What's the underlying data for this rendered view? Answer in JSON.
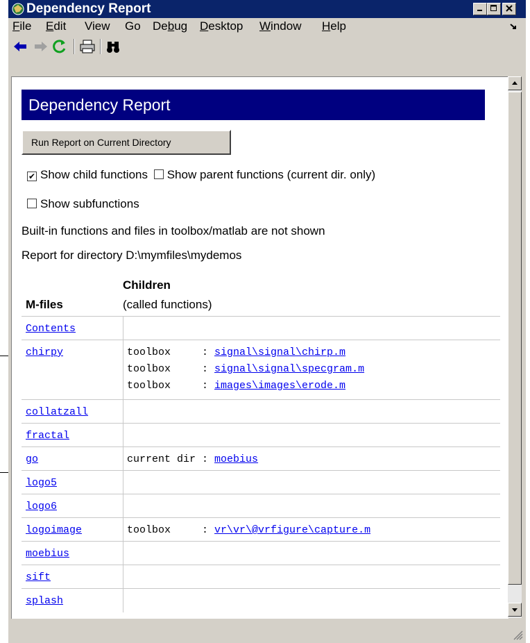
{
  "window": {
    "title": "Dependency Report"
  },
  "menu": {
    "items": [
      {
        "label": "File",
        "u": "F",
        "rest": "ile"
      },
      {
        "label": "Edit",
        "u": "E",
        "rest": "dit"
      },
      {
        "label": "View",
        "u": "",
        "rest": "View"
      },
      {
        "label": "Go",
        "u": "",
        "rest": "Go"
      },
      {
        "label": "Debug",
        "pre": "De",
        "u": "b",
        "rest": "ug"
      },
      {
        "label": "Desktop",
        "u": "D",
        "rest": "esktop"
      },
      {
        "label": "Window",
        "u": "W",
        "rest": "indow"
      },
      {
        "label": "Help",
        "u": "H",
        "rest": "elp"
      }
    ]
  },
  "toolbar": {
    "icons": [
      "back-arrow-icon",
      "forward-arrow-icon",
      "refresh-icon",
      "print-icon",
      "find-binoculars-icon"
    ]
  },
  "report": {
    "heading": "Dependency Report",
    "run_button": "Run Report on Current Directory",
    "options": {
      "child": {
        "label": "Show child functions",
        "checked": true
      },
      "parent": {
        "label": "Show parent functions (current dir. only)",
        "checked": false
      },
      "sub": {
        "label": "Show subfunctions",
        "checked": false
      }
    },
    "note": "Built-in functions and files in toolbox/matlab are not shown",
    "directory_line": "Report for directory D:\\mymfiles\\mydemos",
    "table": {
      "col1_header": "M-files",
      "col2_header_line1": "Children",
      "col2_header_line2": "(called functions)",
      "rows": [
        {
          "file": "Contents",
          "children": []
        },
        {
          "file": "chirpy",
          "children": [
            {
              "type": "toolbox     : ",
              "path": "signal\\signal\\chirp.m"
            },
            {
              "type": "toolbox     : ",
              "path": "signal\\signal\\specgram.m"
            },
            {
              "type": "toolbox     : ",
              "path": "images\\images\\erode.m"
            }
          ]
        },
        {
          "file": "collatzall",
          "children": []
        },
        {
          "file": "fractal",
          "children": []
        },
        {
          "file": "go",
          "children": [
            {
              "type": "current dir : ",
              "path": "moebius"
            }
          ]
        },
        {
          "file": "logo5",
          "children": []
        },
        {
          "file": "logo6",
          "children": []
        },
        {
          "file": "logoimage",
          "children": [
            {
              "type": "toolbox     : ",
              "path": "vr\\vr\\@vrfigure\\capture.m"
            }
          ]
        },
        {
          "file": "moebius",
          "children": []
        },
        {
          "file": "sift",
          "children": []
        },
        {
          "file": "splash",
          "children": []
        }
      ]
    }
  }
}
